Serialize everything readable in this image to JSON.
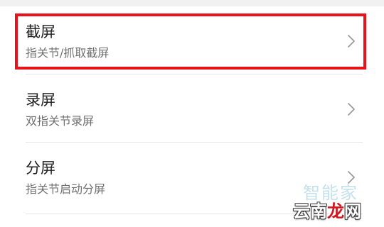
{
  "settings": {
    "items": [
      {
        "title": "截屏",
        "subtitle": "指关节/抓取截屏"
      },
      {
        "title": "录屏",
        "subtitle": "双指关节录屏"
      },
      {
        "title": "分屏",
        "subtitle": "指关节启动分屏"
      }
    ]
  },
  "highlight": {
    "color": "#e8121b"
  },
  "watermark": {
    "line1": "智能家",
    "line2_main": "云南",
    "line2_accent": "龙",
    "line2_end": "网",
    "url": ".com"
  },
  "icons": {
    "chevron": "chevron-right-icon"
  }
}
